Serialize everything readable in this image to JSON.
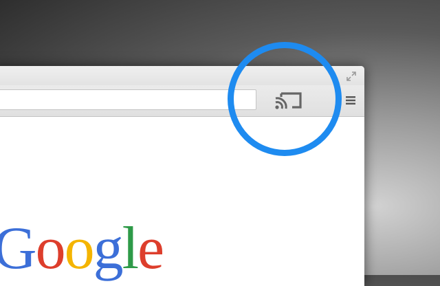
{
  "browser": {
    "omnibox": {
      "value": "",
      "placeholder": ""
    },
    "icons": {
      "cast": "cast-icon",
      "menu": "hamburger-menu-icon",
      "fullscreen": "fullscreen-arrows-icon"
    }
  },
  "page": {
    "logo": {
      "text": "Google",
      "letters": [
        "G",
        "o",
        "o",
        "g",
        "l",
        "e"
      ],
      "colors": [
        "#3c6fd8",
        "#dd3e2c",
        "#f4b400",
        "#3c6fd8",
        "#2e9a48",
        "#dd3e2c"
      ]
    }
  },
  "colors": {
    "highlight": "#1e8bf0",
    "cast_icon": "#666666",
    "menu_icon": "#555555"
  }
}
